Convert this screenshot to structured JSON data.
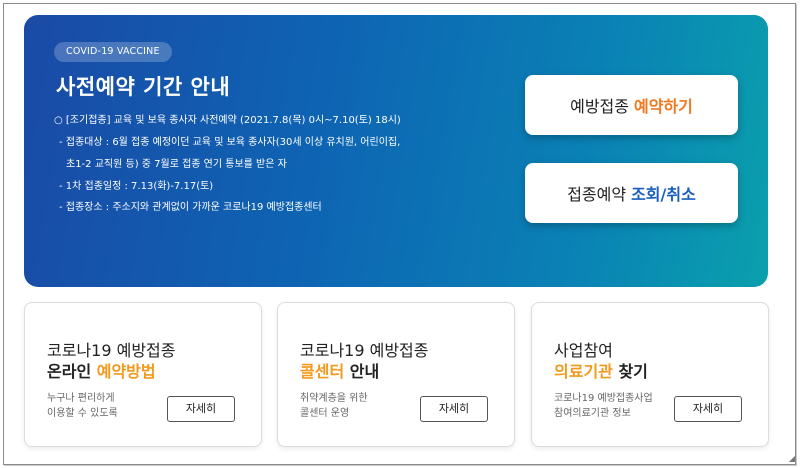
{
  "hero": {
    "badge": "COVID-19 VACCINE",
    "title": "사전예약 기간 안내",
    "info": [
      "○ [조기접종] 교육 및 보육 종사자 사전예약 (2021.7.8(목) 0시~7.10(토) 18시)",
      "- 접종대상 : 6월 접종 예정이던 교육 및 보육 종사자(30세 이상 유치원, 어린이집,",
      "초1-2 교직원 등) 중 7월로 접종 연기 통보를 받은 자",
      "- 1차 접종일정 : 7.13(화)-7.17(토)",
      "- 접종장소 : 주소지와 관계없이 가까운 코로나19 예방접종센터"
    ],
    "reserve_button": {
      "prefix": "예방접종",
      "accent": "예약하기"
    },
    "lookup_button": {
      "prefix": "접종예약",
      "accent": "조회/취소"
    }
  },
  "cards": [
    {
      "title_line1": "코로나19 예방접종",
      "title_line2_plain": "온라인 ",
      "title_line2_accent": "예약방법",
      "title_line2_tail": "",
      "desc_line1": "누구나 편리하게",
      "desc_line2": "이용할 수 있도록",
      "button": "자세히"
    },
    {
      "title_line1": "코로나19 예방접종",
      "title_line2_plain": "",
      "title_line2_accent": "콜센터",
      "title_line2_tail": " 안내",
      "desc_line1": "취약계층을 위한",
      "desc_line2": "콜센터 운영",
      "button": "자세히"
    },
    {
      "title_line1": "사업참여",
      "title_line2_plain": "",
      "title_line2_accent": "의료기관",
      "title_line2_tail": " 찾기",
      "desc_line1": "코로나19 예방접종사업",
      "desc_line2": "참여의료기관 정보",
      "button": "자세히"
    }
  ],
  "colors": {
    "hero_gradient_start": "#1a4aa6",
    "hero_gradient_end": "#0aa0ad",
    "accent_orange": "#f0781e",
    "accent_blue": "#1a5fc0",
    "card_highlight": "#f29a1d"
  }
}
